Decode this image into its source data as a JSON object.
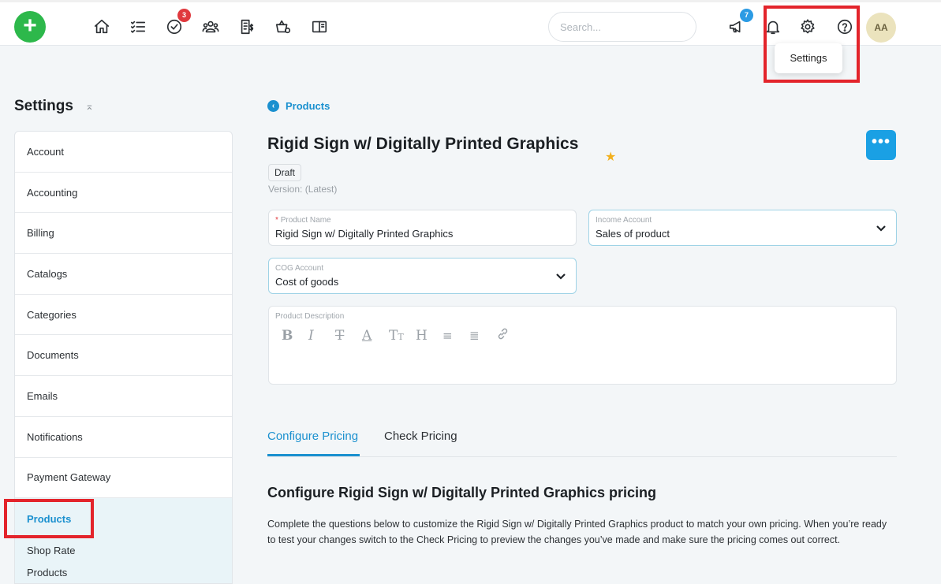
{
  "topbar": {
    "add_label": "+",
    "badges": {
      "tasks": "3",
      "announcements": "7"
    },
    "search_placeholder": "Search...",
    "avatar_initials": "AA",
    "tooltip": "Settings"
  },
  "sidebar": {
    "title": "Settings",
    "collapse_symbol": "⌅",
    "items": [
      "Account",
      "Accounting",
      "Billing",
      "Catalogs",
      "Categories",
      "Documents",
      "Emails",
      "Notifications",
      "Payment Gateway"
    ],
    "active_item": "Products",
    "sub_items": [
      "Shop Rate",
      "Products"
    ]
  },
  "main": {
    "breadcrumb": "Products",
    "title": "Rigid Sign w/ Digitally Printed Graphics",
    "more_label": "•••",
    "status": "Draft",
    "version": "Version: (Latest)",
    "fields": {
      "product_name": {
        "label": "Product Name",
        "value": "Rigid Sign w/ Digitally Printed Graphics"
      },
      "income_account": {
        "label": "Income Account",
        "value": "Sales of product"
      },
      "cog_account": {
        "label": "COG Account",
        "value": "Cost of goods"
      },
      "product_description": {
        "label": "Product Description"
      }
    },
    "tabs": [
      "Configure Pricing",
      "Check Pricing"
    ],
    "section_title": "Configure Rigid Sign w/ Digitally Printed Graphics pricing",
    "section_body": "Complete the questions below to customize the Rigid Sign w/ Digitally Printed Graphics product to match your own pricing. When you’re ready to test your changes switch to the Check Pricing to preview the changes you’ve made and make sure the pricing comes out correct."
  },
  "colors": {
    "accent": "#1a90cf",
    "add_button": "#2db84b",
    "highlight": "#e3242b"
  }
}
